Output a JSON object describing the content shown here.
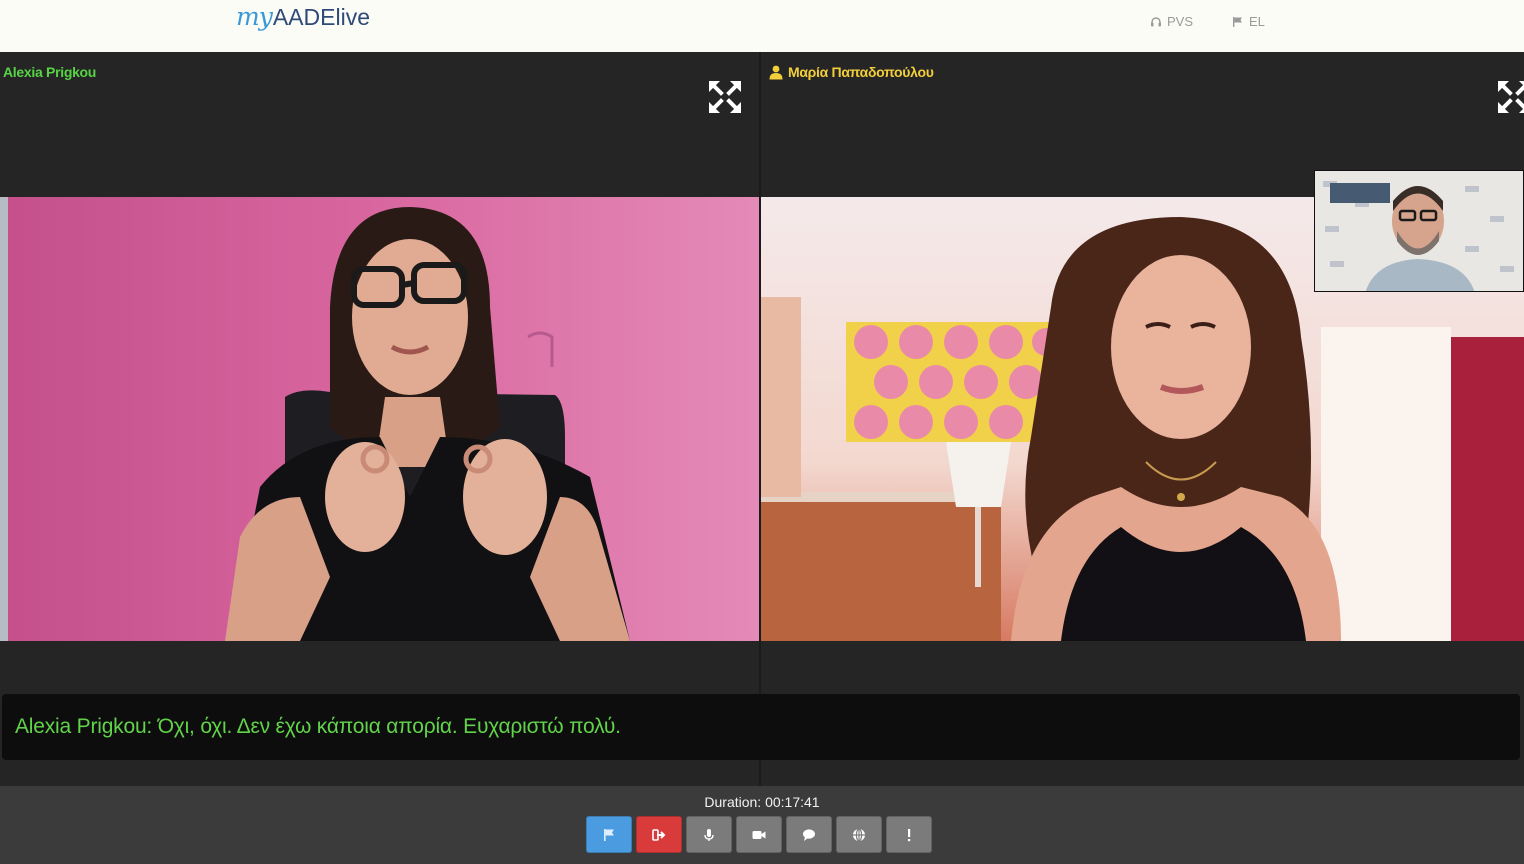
{
  "app": {
    "logo_my": "my",
    "logo_rest": "AADElive"
  },
  "topbar": {
    "support_label": "PVS",
    "language_label": "EL"
  },
  "participants": {
    "left_name": "Alexia Prigkou",
    "right_name": "Μαρία Παπαδοπούλου"
  },
  "caption": {
    "text": "Alexia Prigkou: Όχι, όχι. Δεν έχω κάποια απορία. Ευχαριστώ πολύ."
  },
  "call": {
    "duration_label": "Duration: 00:17:41"
  },
  "toolbar": {
    "buttons": [
      {
        "icon": "flag-icon",
        "color": "#4a9be0"
      },
      {
        "icon": "exit-icon",
        "color": "#d93b3b"
      },
      {
        "icon": "microphone-icon",
        "color": "#7b7b7b"
      },
      {
        "icon": "video-camera-icon",
        "color": "#7b7b7b"
      },
      {
        "icon": "chat-bubble-icon",
        "color": "#7b7b7b"
      },
      {
        "icon": "globe-icon",
        "color": "#7b7b7b"
      },
      {
        "icon": "more-vertical-icon",
        "color": "#7b7b7b"
      }
    ]
  },
  "colors": {
    "caption_text": "#61d34a",
    "left_name": "#57d445",
    "right_name": "#f2cf3a",
    "background": "#252525"
  }
}
